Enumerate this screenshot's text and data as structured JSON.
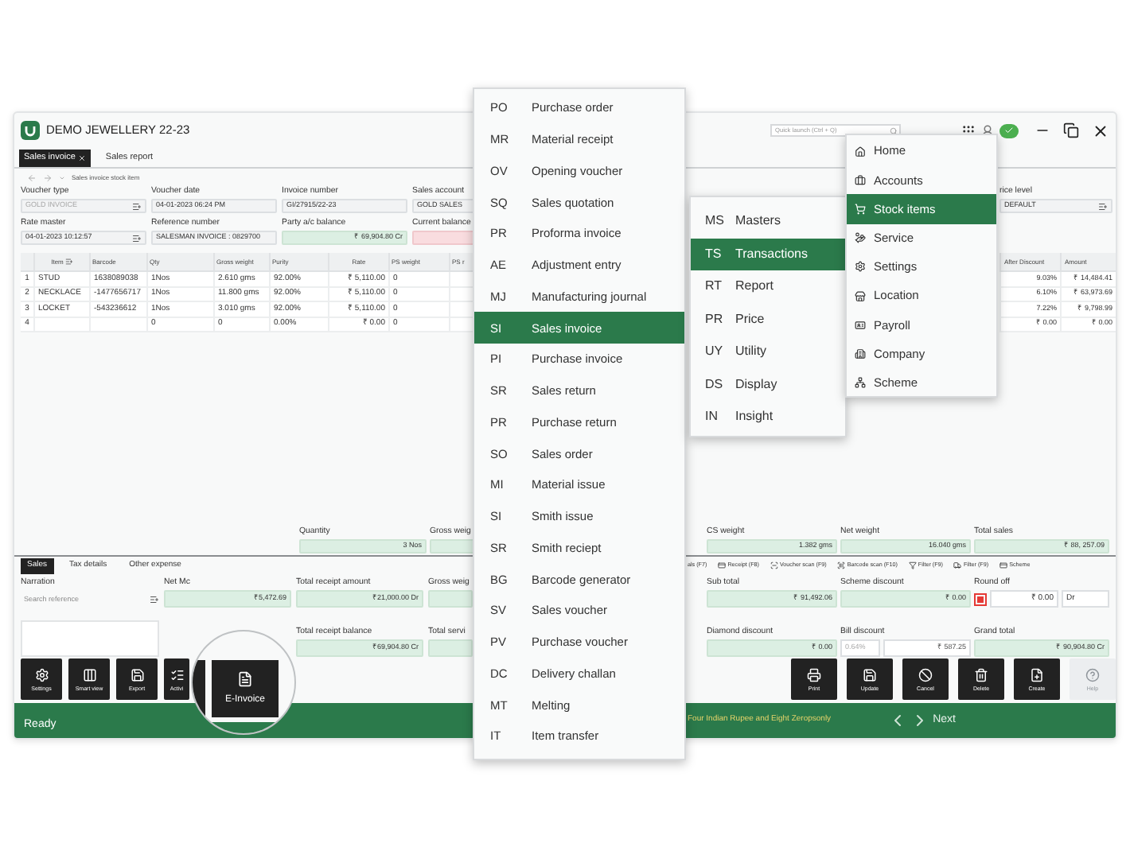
{
  "app": {
    "title": "DEMO JEWELLERY 22-23",
    "search": {
      "placeholder": "Quick launch (Ctrl + Q)"
    }
  },
  "tabs": [
    {
      "label": "Sales invoice",
      "selected": true
    },
    {
      "label": "Sales report",
      "selected": false
    }
  ],
  "breadcrumb": "Sales invoice stock item",
  "header_rows": [
    [
      {
        "label": "Voucher type",
        "value": "GOLD INVOICE",
        "kind": "disabled",
        "picker": true
      },
      {
        "label": "Voucher date",
        "value": "04-01-2023 06:24 PM",
        "kind": "input",
        "picker": false
      },
      {
        "label": "Invoice number",
        "value": "GI/27915/22-23",
        "kind": "input",
        "picker": false
      },
      {
        "label": "Sales account",
        "value": "GOLD SALES",
        "kind": "input",
        "picker": false
      }
    ],
    [
      {
        "label": "Rate master",
        "value": "04-01-2023 10:12:57",
        "kind": "input",
        "picker": true
      },
      {
        "label": "Reference number",
        "value": "SALESMAN INVOICE : 0829700",
        "kind": "input",
        "picker": false
      },
      {
        "label": "Party a/c balance",
        "value": "₹ 69,904.80 Cr",
        "kind": "balance",
        "picker": false
      },
      {
        "label": "Current balance",
        "kind": "alert",
        "picker": false
      }
    ]
  ],
  "price_level": {
    "label": "rice level",
    "value": "DEFAULT",
    "kind": "input",
    "picker": true
  },
  "table": {
    "columns": [
      {
        "label": "Item",
        "picker": true
      },
      {
        "label": "Barcode",
        "picker": false
      },
      {
        "label": "Qty",
        "picker": false
      },
      {
        "label": "Gross weight",
        "picker": false
      },
      {
        "label": "Purity",
        "picker": false
      },
      {
        "label": "Rate",
        "picker": false
      },
      {
        "label": "PS weight",
        "picker": false
      },
      {
        "label": "PS r",
        "picker": false
      }
    ],
    "rows": [
      {
        "number": "1",
        "cells": [
          "STUD",
          "1638089038",
          "1Nos",
          "2.610 gms",
          "92.00%",
          "₹ 5,110.00",
          "0",
          null
        ]
      },
      {
        "number": "2",
        "cells": [
          "NECKLACE",
          "-1477656717",
          "1Nos",
          "11.800 gms",
          "92.00%",
          "₹ 5,110.00",
          "0",
          null
        ]
      },
      {
        "number": "3",
        "cells": [
          "LOCKET",
          "-543236612",
          "1Nos",
          "3.010 gms",
          "92.00%",
          "₹ 5,110.00",
          "0",
          null
        ]
      },
      {
        "number": "4",
        "cells": [
          null,
          null,
          "0",
          "0",
          "0.00%",
          "₹ 0.00",
          "0",
          null
        ]
      }
    ],
    "right_columns": [
      "After Discount",
      "Amount"
    ],
    "right_rows": [
      [
        "9.03%",
        "₹ 14,484.41"
      ],
      [
        "6.10%",
        "₹ 63,973.69"
      ],
      [
        "7.22%",
        "₹ 9,798.99"
      ],
      [
        "₹ 0.00",
        "₹ 0.00"
      ]
    ]
  },
  "summary_left": [
    {
      "label": "Quantity",
      "value": "3 Nos",
      "kind": "balance",
      "picker": false
    },
    {
      "label": "Gross weig",
      "kind": "balance",
      "picker": false
    }
  ],
  "summary_right": [
    {
      "label": "CS weight",
      "value": "1.382 gms",
      "kind": "balance",
      "picker": false
    },
    {
      "label": "Net weight",
      "value": "16.040 gms",
      "kind": "balance",
      "picker": false
    },
    {
      "label": "Total sales",
      "value": "₹ 88, 257.09",
      "kind": "balance",
      "picker": false
    }
  ],
  "bottom_tabs": [
    {
      "label": "Sales",
      "selected": true
    },
    {
      "label": "Tax details",
      "selected": false
    },
    {
      "label": "Other expense",
      "selected": false
    }
  ],
  "toolbar": [
    "als (F7)",
    "Receipt (F8)",
    "Voucher scan (F9)",
    "Barcode scan (F10)",
    "Filter (F9)",
    "Filter (F9)",
    "Scheme"
  ],
  "narration": {
    "label": "Narration",
    "placeholder": "Search reference"
  },
  "footer_left_row1": [
    {
      "label": "Net Mc",
      "value": "₹5,472.69",
      "kind": "balance",
      "picker": false
    },
    {
      "label": "Total receipt amount",
      "value": "₹21,000.00 Dr",
      "kind": "balance",
      "picker": false
    },
    {
      "label": "Gross weig",
      "kind": "balance",
      "picker": false
    }
  ],
  "footer_left_row2": [
    {
      "label": "Total receipt balance",
      "value": "₹69,904.80 Cr",
      "kind": "balance",
      "picker": false
    },
    {
      "label": "Total servi",
      "kind": "balance",
      "picker": false
    }
  ],
  "footer_right_row1": [
    {
      "label": "Sub total",
      "value": "₹ 91,492.06",
      "kind": "balance",
      "picker": false
    },
    {
      "label": "Scheme discount",
      "value": "₹ 0.00",
      "kind": "balance",
      "picker": false
    },
    {
      "label": "Round off",
      "kind": "round_off",
      "checked": true,
      "parts": [
        {
          "text": "₹ 0.00"
        },
        {
          "text": "Dr"
        }
      ]
    }
  ],
  "footer_right_row2": [
    {
      "label": "Diamond discount",
      "value": "₹ 0.00",
      "kind": "balance",
      "picker": false
    },
    {
      "label": "Bill discount",
      "kind": "split",
      "parts": [
        {
          "text": "0.64%",
          "disabled": true
        },
        {
          "text": "₹ 587.25",
          "disabled": false
        }
      ]
    },
    {
      "label": "Grand total",
      "value": "₹ 90,904.80 Cr",
      "kind": "balance",
      "picker": false
    }
  ],
  "left_buttons": [
    "Settings",
    "Smart view",
    "Export",
    "Activi"
  ],
  "right_buttons": [
    {
      "label": "Print",
      "disabled": false
    },
    {
      "label": "Update",
      "disabled": false
    },
    {
      "label": "Cancel",
      "disabled": false
    },
    {
      "label": "Delete",
      "disabled": false
    },
    {
      "label": "Create",
      "disabled": false
    },
    {
      "label": "Help",
      "disabled": true
    }
  ],
  "status": {
    "text": "Ready",
    "amount_words": "Four Indian Rupee and Eight Zeropsonly",
    "next": "Next"
  },
  "magnifier": {
    "button": "E-Invoice"
  },
  "menu_vouchers": [
    {
      "code": "PO",
      "label": "Purchase order",
      "selected": false
    },
    {
      "code": "MR",
      "label": "Material receipt",
      "selected": false
    },
    {
      "code": "OV",
      "label": "Opening voucher",
      "selected": false
    },
    {
      "code": "SQ",
      "label": "Sales quotation",
      "selected": false
    },
    {
      "code": "PR",
      "label": "Proforma invoice",
      "selected": false
    },
    {
      "code": "AE",
      "label": "Adjustment entry",
      "selected": false
    },
    {
      "code": "MJ",
      "label": "Manufacturing journal",
      "selected": false
    },
    {
      "code": "SI",
      "label": "Sales invoice",
      "selected": true
    },
    {
      "code": "PI",
      "label": "Purchase invoice",
      "selected": false
    },
    {
      "code": "SR",
      "label": "Sales return",
      "selected": false
    },
    {
      "code": "PR",
      "label": "Purchase return",
      "selected": false
    },
    {
      "code": "SO",
      "label": "Sales order",
      "selected": false
    },
    {
      "code": "MI",
      "label": "Material issue",
      "selected": false
    },
    {
      "code": "SI",
      "label": "Smith issue",
      "selected": false
    },
    {
      "code": "SR",
      "label": "Smith reciept",
      "selected": false
    },
    {
      "code": "BG",
      "label": "Barcode generator",
      "selected": false
    },
    {
      "code": "SV",
      "label": "Sales voucher",
      "selected": false
    },
    {
      "code": "PV",
      "label": "Purchase voucher",
      "selected": false
    },
    {
      "code": "DC",
      "label": "Delivery challan",
      "selected": false
    },
    {
      "code": "MT",
      "label": "Melting",
      "selected": false
    },
    {
      "code": "IT",
      "label": "Item transfer",
      "selected": false
    }
  ],
  "menu_modules": [
    {
      "code": "MS",
      "label": "Masters",
      "selected": false
    },
    {
      "code": "TS",
      "label": "Transactions",
      "selected": true
    },
    {
      "code": "RT",
      "label": "Report",
      "selected": false
    },
    {
      "code": "PR",
      "label": "Price",
      "selected": false
    },
    {
      "code": "UY",
      "label": "Utility",
      "selected": false
    },
    {
      "code": "DS",
      "label": "Display",
      "selected": false
    },
    {
      "code": "IN",
      "label": "Insight",
      "selected": false
    }
  ],
  "menu_main": [
    {
      "label": "Home",
      "selected": false
    },
    {
      "label": "Accounts",
      "selected": false
    },
    {
      "label": "Stock items",
      "selected": true
    },
    {
      "label": "Service",
      "selected": false
    },
    {
      "label": "Settings",
      "selected": false
    },
    {
      "label": "Location",
      "selected": false
    },
    {
      "label": "Payroll",
      "selected": false
    },
    {
      "label": "Company",
      "selected": false
    },
    {
      "label": "Scheme",
      "selected": false
    }
  ]
}
